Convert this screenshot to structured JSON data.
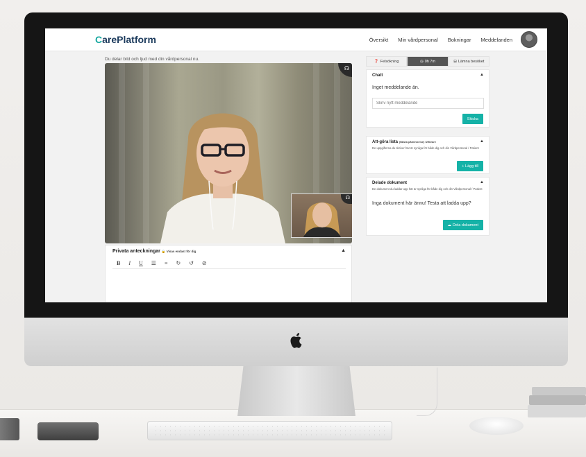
{
  "app": {
    "brand": "CarePlatform",
    "brand_first_letter": "C",
    "brand_rest": "arePlatform"
  },
  "nav": {
    "items": [
      "Översikt",
      "Min vårdpersonal",
      "Bokningar",
      "Meddelanden"
    ]
  },
  "call": {
    "sharing_notice": "Du delar bild och ljud med din vårdpersonal nu."
  },
  "tabs": {
    "troubleshoot": "Felsökning",
    "timer": "0h 7m",
    "leave": "Lämna besöket"
  },
  "chat": {
    "title": "Chatt",
    "empty_text": "Inget meddelande än.",
    "input_placeholder": "Skriv nytt meddelande",
    "send_label": "Skicka"
  },
  "todo": {
    "title": "Att-göra lista",
    "title_suffix": "(Nästa påminnelse) Utförare",
    "description": "De uppgifterna du skriver här är synliga för både dig och din Vårdpersonal / Patient",
    "add_label": "+ Lägg till"
  },
  "documents": {
    "title": "Delade dokument",
    "description": "De dokument du laddar upp här är synliga för både dig och din Vårdpersonal / Patient",
    "empty_text": "Inga dokument här ännu! Testa att ladda upp?",
    "share_label": "Dela dokument"
  },
  "notes": {
    "title": "Privata anteckningar",
    "visibility": "Visas endast för dig",
    "toolbar": [
      "B",
      "I",
      "U",
      "☰",
      "≡",
      "↻",
      "↺",
      "⊘"
    ]
  },
  "colors": {
    "accent": "#15b2a7",
    "brand_dark": "#1b3a5c",
    "timer_tab": "#555555"
  },
  "icons": {
    "headset": "headset-icon",
    "lock": "lock-icon",
    "apple": "apple-logo"
  }
}
